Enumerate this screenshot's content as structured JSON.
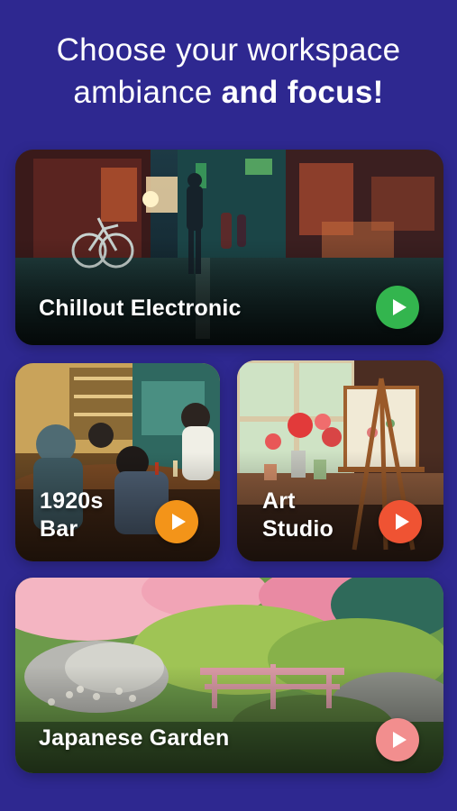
{
  "header": {
    "line1": "Choose your workspace",
    "line2_regular": "ambiance ",
    "line2_bold": "and focus!"
  },
  "cards": [
    {
      "label_lines": [
        "Chillout Electronic"
      ],
      "play_color": "#33b54e",
      "icon": "play-icon"
    },
    {
      "label_lines": [
        "1920s",
        "Bar"
      ],
      "play_color": "#f39419",
      "icon": "play-icon"
    },
    {
      "label_lines": [
        "Art",
        "Studio"
      ],
      "play_color": "#ef5333",
      "icon": "play-icon"
    },
    {
      "label_lines": [
        "Japanese Garden"
      ],
      "play_color": "#f28e8e",
      "icon": "play-icon"
    }
  ],
  "colors": {
    "background": "#2e2890",
    "text": "#ffffff"
  }
}
